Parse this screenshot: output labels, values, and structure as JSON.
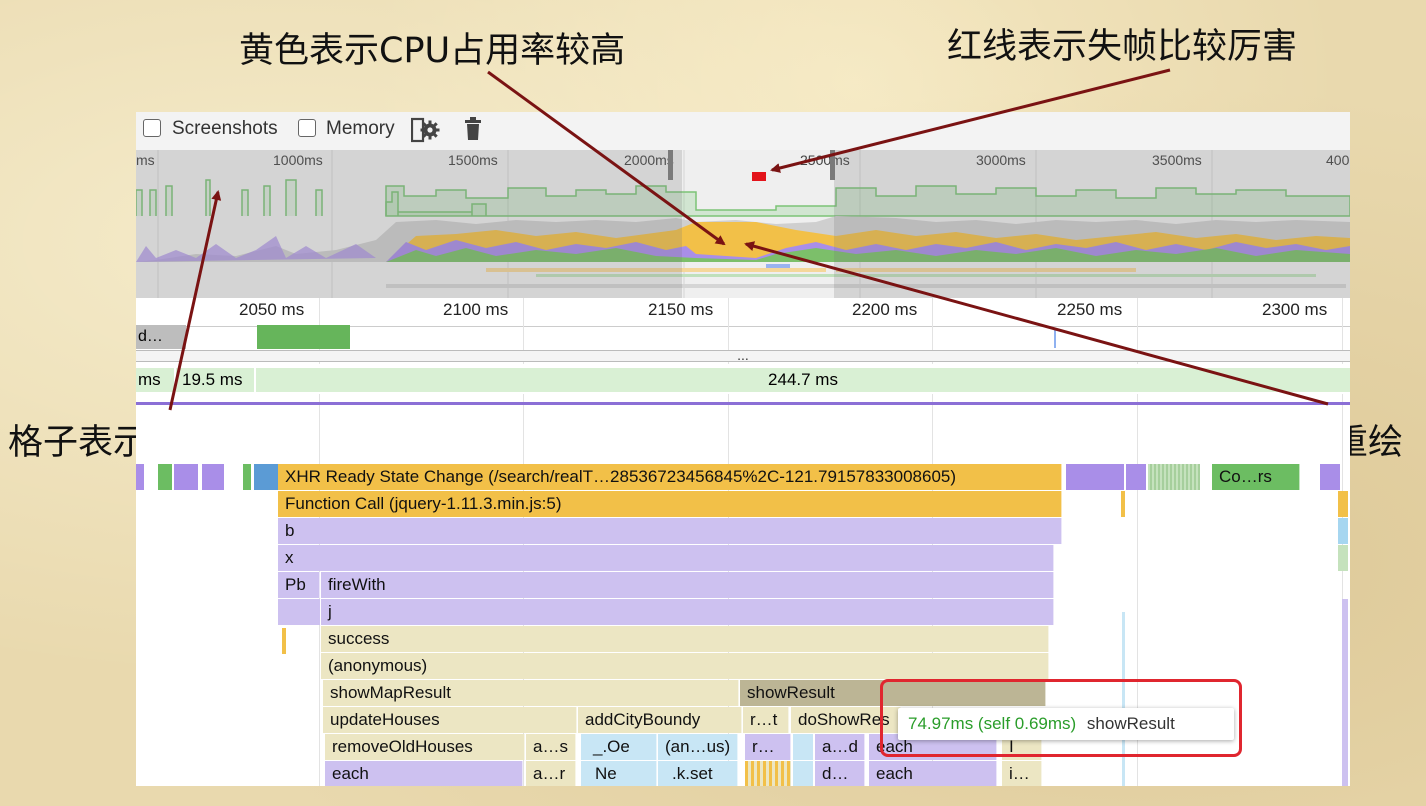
{
  "annotations": {
    "yellow_cpu": "黄色表示CPU占用率较高",
    "red_line": "红线表示失帧比较厉害",
    "grid_fps": "格子表示帧率",
    "purple_repaint": "紫色表示重绘"
  },
  "toolbar": {
    "screenshots_label": "Screenshots",
    "memory_label": "Memory",
    "settings_icon": "gear-icon",
    "trash_icon": "trash-icon"
  },
  "overview_ruler": {
    "t0": "ms",
    "t1": "1000ms",
    "t2": "1500ms",
    "t3": "2000ms",
    "t4": "2500ms",
    "t5": "3000ms",
    "t6": "3500ms",
    "t7": "400"
  },
  "detail_ruler": {
    "t1": "2050 ms",
    "t2": "2100 ms",
    "t3": "2150 ms",
    "t4": "2200 ms",
    "t5": "2250 ms",
    "t6": "2300 ms"
  },
  "network_row": {
    "item": "d…",
    "dots": "..."
  },
  "frames": {
    "f0": "ms",
    "f1": "19.5 ms",
    "f2": "244.7 ms"
  },
  "flame": {
    "xhr": "XHR Ready State Change (/search/realT…28536723456845%2C-121.79157833008605)",
    "right_label": "Co…rs",
    "function_call": "Function Call (jquery-1.11.3.min.js:5)",
    "b": "b",
    "x": "x",
    "pb": "Pb",
    "firewith": "fireWith",
    "j": "j",
    "success": "success",
    "anonymous": "(anonymous)",
    "showmapresult": "showMapResult",
    "showresult": "showResult",
    "updatehouses": "updateHouses",
    "addcityboundy": "addCityBoundy",
    "rt": "r…t",
    "doshowres": "doShowRes",
    "removeoldhouses": "removeOldHouses",
    "as": "a…s",
    "oe": "_.Oe",
    "anus": "(an…us)",
    "r2": "r…",
    "ad": "a…d",
    "each1": "each",
    "i1": "I",
    "each2": "each",
    "ar": "a…r",
    "ne": "Ne",
    "kset": ".k.set",
    "d2": "d…",
    "each3": "each",
    "i2": "i…"
  },
  "tooltip": {
    "time": "74.97ms (self 0.69ms)",
    "name": "showResult"
  },
  "colors": {
    "scripting": "#f2c048",
    "rendering": "#a98ee8",
    "painting": "#6cbd62",
    "frame": "#d9f0d4",
    "arrow": "#7a1313",
    "highlight": "#e0262f"
  }
}
